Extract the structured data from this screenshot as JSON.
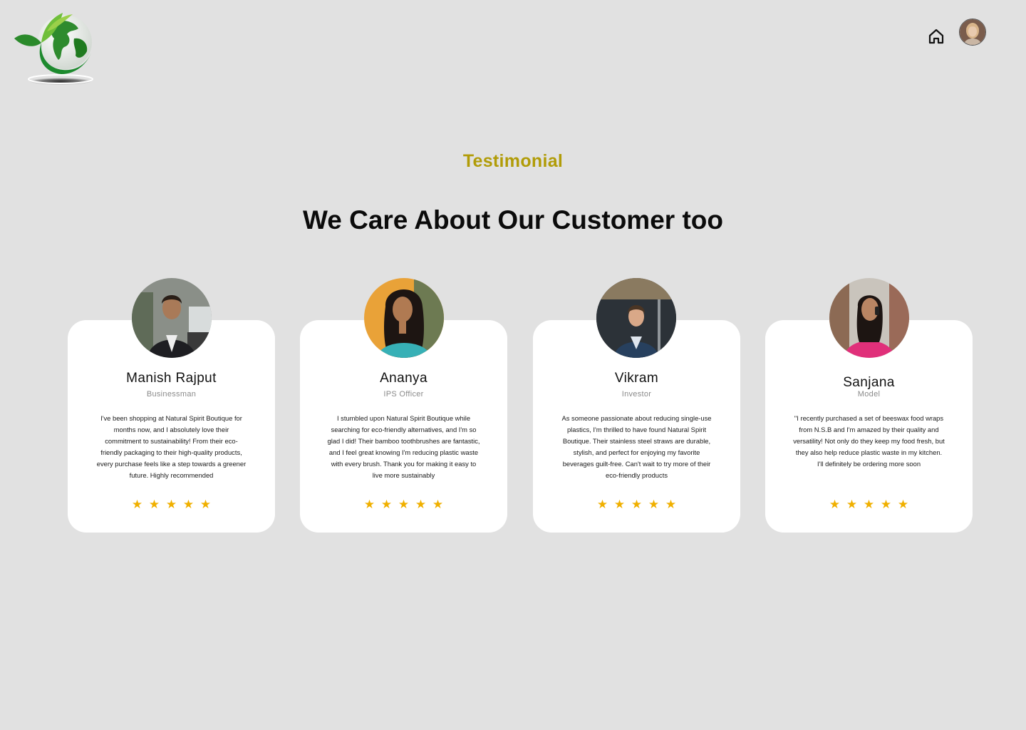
{
  "header": {
    "logo_icon": "globe-leaf-logo-icon",
    "home_icon": "home-icon",
    "avatar_icon": "user-avatar"
  },
  "section": {
    "eyebrow": "Testimonial",
    "headline": "We Care About Our Customer too"
  },
  "colors": {
    "background": "#e1e1e1",
    "card": "#ffffff",
    "eyebrow": "#b19c08",
    "star": "#f0b000"
  },
  "testimonials": [
    {
      "name": "Manish Rajput",
      "role": "Businessman",
      "quote": "I've been shopping at Natural Spirit Boutique for months now, and I absolutely love their commitment to sustainability! From their eco-friendly packaging to their high-quality products, every purchase feels like a step towards a greener future. Highly recommended",
      "rating": 5
    },
    {
      "name": "Ananya",
      "role": "IPS Officer",
      "quote": "I stumbled upon Natural Spirit Boutique while searching for eco-friendly alternatives, and I'm so glad I did! Their bamboo toothbrushes are fantastic, and I feel great knowing I'm reducing plastic waste with every brush. Thank you for making it easy to live more sustainably",
      "rating": 5
    },
    {
      "name": "Vikram",
      "role": "Investor",
      "quote": "As someone passionate about reducing single-use plastics, I'm thrilled to have found Natural Spirit Boutique. Their stainless steel straws are durable, stylish, and perfect for enjoying my favorite beverages guilt-free. Can't wait to try more of their eco-friendly products",
      "rating": 5
    },
    {
      "name": "Sanjana",
      "role": "Model",
      "quote": "\"I recently purchased a set of beeswax food wraps from N.S.B and I'm amazed by their quality and versatility! Not only do they keep my food fresh, but they also help reduce plastic waste in my kitchen. I'll definitely be ordering more soon",
      "rating": 5
    }
  ]
}
